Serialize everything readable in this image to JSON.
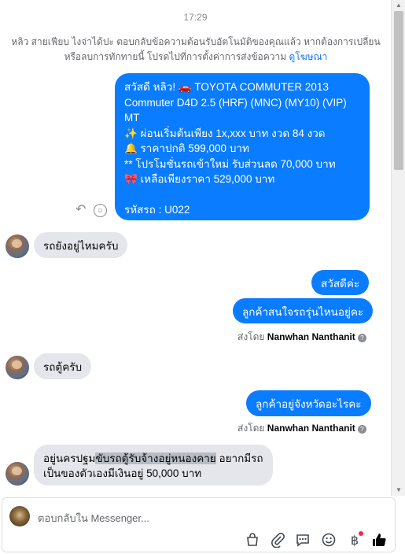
{
  "thread": {
    "timestamp": "17:29",
    "notice_text": "หลิว สายเฟียบ ไงจ่าได้ปะ ตอบกลับข้อความต้อนรับอัตโนมัติของคุณแล้ว หากต้องการเปลี่ยนหรือลบการทักทายนี้ โปรดไปที่การตั้งค่าการส่งข้อความ",
    "notice_link": "ดูโฆษณา",
    "messages": {
      "intro": "สวัสดี หลิว! 🚗 TOYOTA COMMUTER 2013 Commuter D4D 2.5 (HRF) (MNC) (MY10) (VIP) MT\n✨ ผ่อนเริ่มต้นเพียง 1x,xxx บาท งวด 84 งวด\n🔔 ราคาปกติ 599,000 บาท\n** โปรโมชั่นรถเข้าใหม่ รับส่วนลด 70,000 บาท\n🎀 เหลือเพียงราคา 529,000 บาท\n\nรหัสรถ : U022",
      "in_1": "รถยังอยู่ไหมครับ",
      "out_1": "สวัสดีค่ะ",
      "out_2": "ลูกค้าสนใจรถรุ่นไหนอยู่คะ",
      "sent_by_1_prefix": "ส่งโดย",
      "sent_by_1_name": "Nanwhan Nanthanit",
      "in_2": "รถตู้ครับ",
      "out_3": "ลูกค้าอยู่จังหวัดอะไรคะ",
      "sent_by_2_prefix": "ส่งโดย",
      "sent_by_2_name": "Nanwhan Nanthanit",
      "in_3_part1": "อยู่นครปฐม",
      "in_3_highlight": "ขับรถตู้รับจ้างอยู่หนองคาย",
      "in_3_part2": " อยากมีรถ",
      "in_3_line2": "เป็นของตัวเองมีเงินอยู่ 50,000 บาท"
    }
  },
  "composer": {
    "placeholder": "ตอบกลับใน Messenger...",
    "tools": [
      "bag-icon",
      "attachment-icon",
      "saved-reply-icon",
      "emoji-icon",
      "payment-icon",
      "like-icon"
    ]
  },
  "colors": {
    "outgoing_bubble": "#0a7cff",
    "incoming_bubble": "#e4e6eb",
    "link": "#1877f2"
  }
}
